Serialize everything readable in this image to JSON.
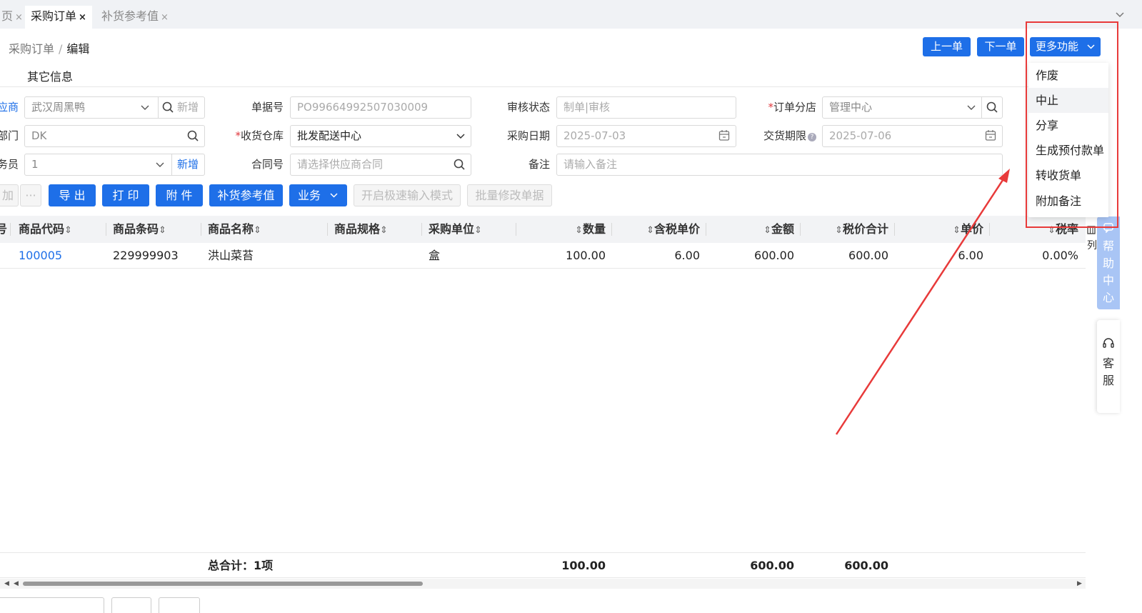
{
  "tabs": [
    {
      "label": "页",
      "close": "×"
    },
    {
      "label": "采购订单",
      "close": "×"
    },
    {
      "label": "补货参考值",
      "close": "×"
    }
  ],
  "breadcrumb": {
    "parent": "采购订单",
    "separator": "/",
    "current": "编辑"
  },
  "top_buttons": {
    "prev": "上一单",
    "next": "下一单",
    "more": "更多功能"
  },
  "more_menu": [
    "作废",
    "中止",
    "分享",
    "生成预付款单",
    "转收货单",
    "附加备注"
  ],
  "section_title": "其它信息",
  "form": {
    "supplier": {
      "label": "应商",
      "value": "武汉周黑鸭",
      "add": "新增"
    },
    "doc_no": {
      "label": "单据号",
      "value": "PO99664992507030009"
    },
    "audit_status": {
      "label": "审核状态",
      "value": "制单|审核"
    },
    "branch": {
      "label": "订单分店",
      "required": "*",
      "value": "管理中心"
    },
    "dept": {
      "label": "部门",
      "value": "DK"
    },
    "warehouse": {
      "label": "收货仓库",
      "required": "*",
      "value": "批发配送中心"
    },
    "purchase_date": {
      "label": "采购日期",
      "value": "2025-07-03"
    },
    "delivery_deadline": {
      "label": "交货期限",
      "value": "2025-07-06",
      "help": "?"
    },
    "salesman": {
      "label": "务员",
      "value": "1",
      "add": "新增"
    },
    "contract": {
      "label": "合同号",
      "placeholder": "请选择供应商合同"
    },
    "remark": {
      "label": "备注",
      "placeholder": "请输入备注"
    }
  },
  "actions": {
    "add": "加",
    "more": "···",
    "export": "导 出",
    "print": "打 印",
    "attach": "附 件",
    "replenish": "补货参考值",
    "business": "业务",
    "fast_input": "开启极速输入模式",
    "batch_edit": "批量修改单据"
  },
  "table": {
    "headers": {
      "idx": "号",
      "code": "商品代码",
      "barcode": "商品条码",
      "name": "商品名称",
      "spec": "商品规格",
      "unit": "采购单位",
      "qty": "数量",
      "tax_price": "含税单价",
      "amount": "金额",
      "total": "税价合计",
      "price": "单价",
      "tax_rate": "税率"
    },
    "sort_icon": "⇕",
    "rows": [
      {
        "code": "100005",
        "barcode": "229999903",
        "name": "洪山菜苔",
        "spec": "",
        "unit": "盒",
        "qty": "100.00",
        "tax_price": "6.00",
        "amount": "600.00",
        "total": "600.00",
        "price": "6.00",
        "tax_rate": "0.00%"
      }
    ],
    "footer": {
      "label": "总合计：1项",
      "qty": "100.00",
      "amount": "600.00",
      "total": "600.00"
    }
  },
  "side": {
    "help_center": [
      "帮",
      "助",
      "中",
      "心"
    ],
    "kefu": [
      "客",
      "服"
    ],
    "col_ctrl": [
      "列"
    ]
  },
  "colors": {
    "primary": "#1e6fe8",
    "annotation_red": "#e83a3a",
    "required": "#e0393e"
  }
}
